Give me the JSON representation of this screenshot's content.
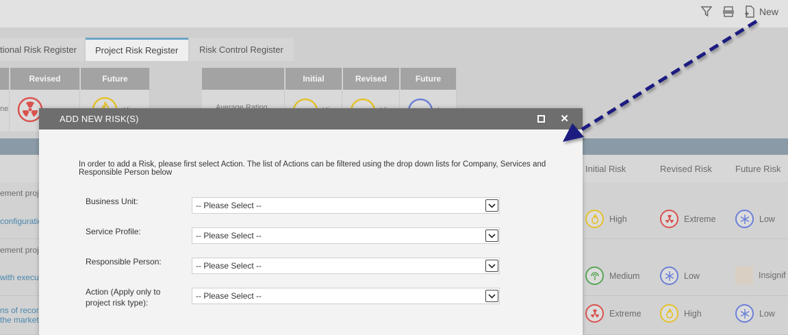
{
  "toolbar": {
    "filter_icon": "filter-icon",
    "export_icon": "export-xls-icon",
    "new_label": "New"
  },
  "tabs": [
    {
      "label": "tional Risk Register",
      "active": false
    },
    {
      "label": "Project Risk Register",
      "active": true
    },
    {
      "label": "Risk Control Register",
      "active": false
    }
  ],
  "rating_left": {
    "headers": [
      "Revised",
      "Future"
    ],
    "side_text": "ne",
    "future_text": "Hi"
  },
  "rating_right": {
    "row_label": "Average Rating",
    "headers": [
      "Initial",
      "Revised",
      "Future"
    ],
    "initial_text": "Hi",
    "revised_text": "Hi",
    "future_text": "L"
  },
  "grid": {
    "headers": [
      "Initial Risk",
      "Revised Risk",
      "Future Risk"
    ],
    "rows": [
      {
        "text": "ement proj",
        "link": "configuratio",
        "initial": "High",
        "revised": "Extreme",
        "future": "Low"
      },
      {
        "text": "ement proj",
        "link": "with execu",
        "initial": "Medium",
        "revised": "Low",
        "future": "Insignif"
      },
      {
        "text": "ns of recor",
        "link": "the market",
        "initial": "Extreme",
        "revised": "High",
        "future": "Low"
      }
    ]
  },
  "colors": {
    "extreme": "#d9534f",
    "high": "#e5c12a",
    "medium": "#5aa65a",
    "low": "#6b7fd7",
    "modal_header": "#6e6e6e",
    "arrow": "#1a1a80"
  },
  "modal": {
    "title": "ADD NEW RISK(S)",
    "intro": "In order to add a Risk, please first select Action. The list of Actions can be filtered using the drop down lists for Company, Services and Responsible Person below",
    "fields": [
      {
        "label": "Business Unit:",
        "value": "-- Please Select --"
      },
      {
        "label": "Service Profile:",
        "value": "-- Please Select --"
      },
      {
        "label": "Responsible Person:",
        "value": "-- Please Select --"
      },
      {
        "label": "Action (Apply only to project risk type):",
        "value": "-- Please Select --"
      }
    ]
  }
}
